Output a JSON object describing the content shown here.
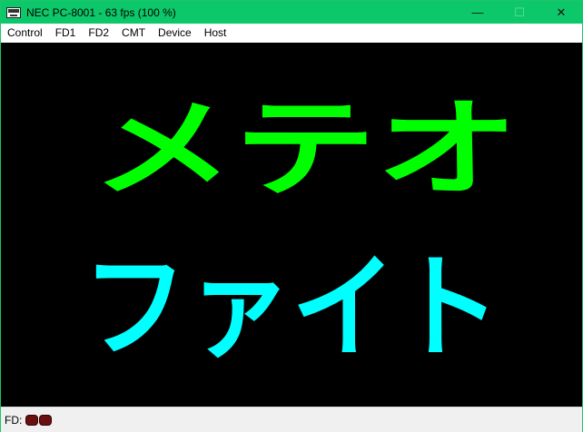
{
  "window": {
    "title": "NEC PC-8001 - 63 fps (100 %)",
    "minimize_glyph": "—",
    "maximize_glyph": "☐",
    "close_glyph": "✕",
    "title_bar_color": "#0dc86a"
  },
  "menubar": {
    "items": [
      "Control",
      "FD1",
      "FD2",
      "CMT",
      "Device",
      "Host"
    ]
  },
  "screen": {
    "line1": "メテオ",
    "line2": "ファイト",
    "line1_color": "#00ff00",
    "line2_color": "#00ffff",
    "background": "#000000"
  },
  "statusbar": {
    "label": "FD:",
    "led_color": "#6b1010"
  }
}
